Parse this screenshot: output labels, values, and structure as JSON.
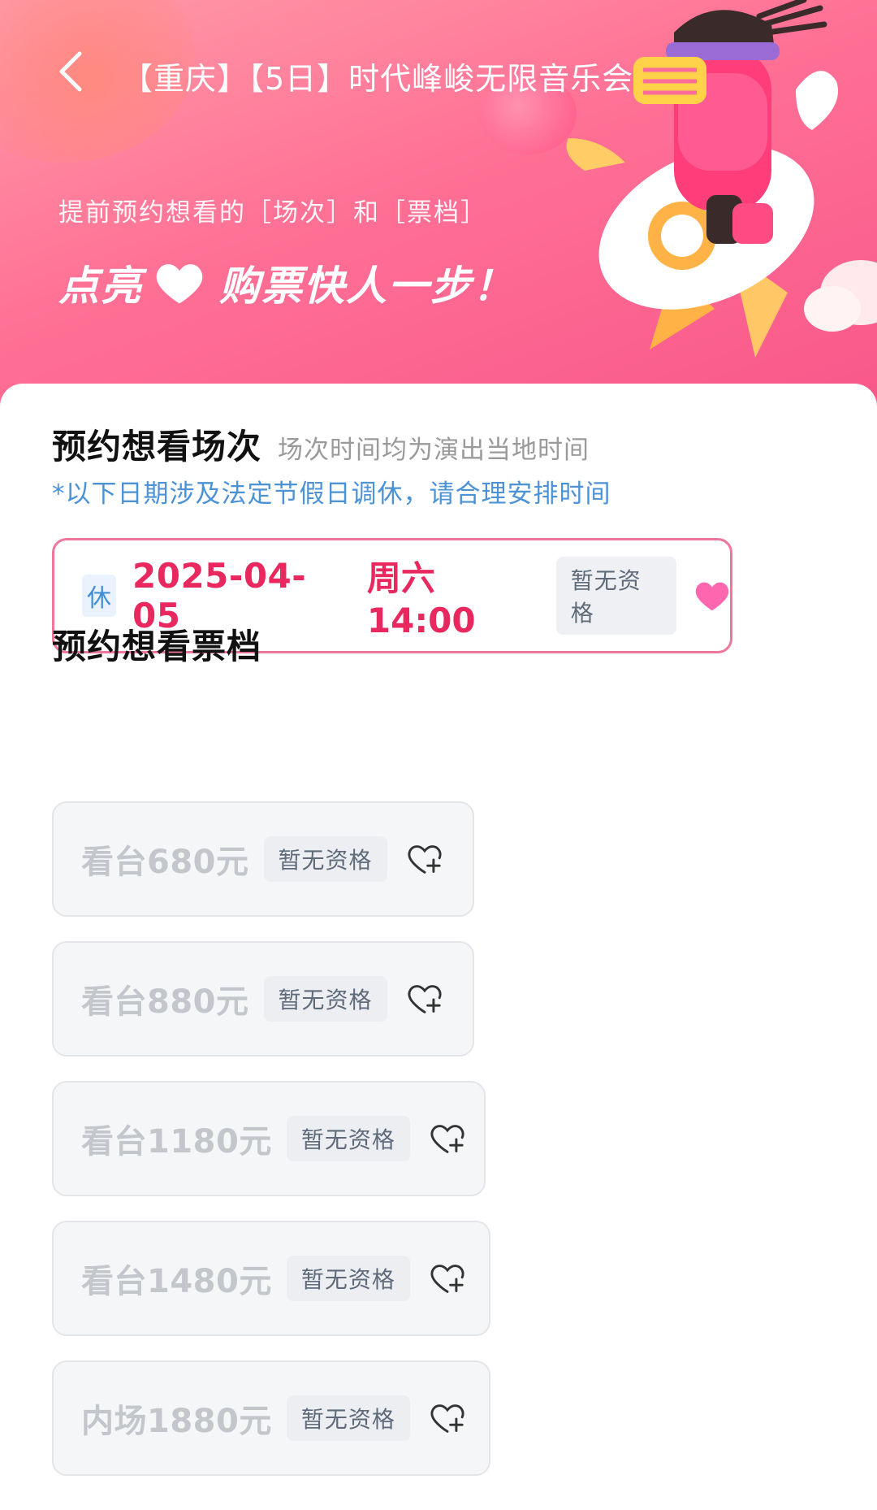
{
  "header": {
    "title": "【重庆】【5日】时代峰峻无限音乐会·极限",
    "promo_line1": "提前预约想看的［场次］和［票档］",
    "promo_part1": "点亮",
    "promo_part2": "购票快人一步！"
  },
  "session_section": {
    "title": "预约想看场次",
    "subtitle": "场次时间均为演出当地时间",
    "notice": "*以下日期涉及法定节假日调休，请合理安排时间",
    "session": {
      "badge": "休",
      "date": "2025-04-05",
      "time": "周六14:00",
      "status": "暂无资格",
      "liked": true
    }
  },
  "tier_section": {
    "title": "预约想看票档",
    "tiers": [
      {
        "name": "看台680元",
        "status": "暂无资格"
      },
      {
        "name": "看台880元",
        "status": "暂无资格"
      },
      {
        "name": "看台1180元",
        "status": "暂无资格"
      },
      {
        "name": "看台1480元",
        "status": "暂无资格"
      },
      {
        "name": "内场1880元",
        "status": "暂无资格"
      }
    ]
  },
  "colors": {
    "accent": "#e8285f",
    "border_active": "#f0779c",
    "notice": "#4b92d6",
    "heart_filled": "#ff66b0"
  }
}
